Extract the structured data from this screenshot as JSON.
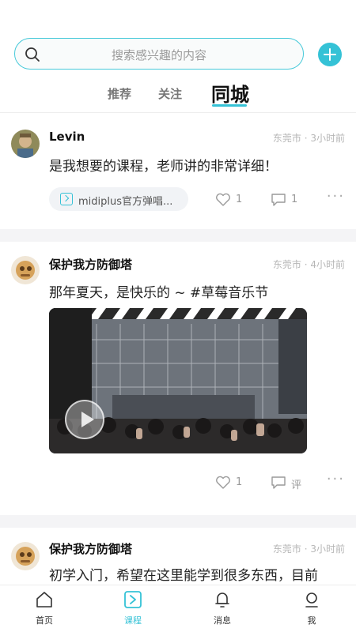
{
  "search": {
    "placeholder": "搜索感兴趣的内容"
  },
  "tabs": [
    {
      "label": "推荐"
    },
    {
      "label": "关注"
    },
    {
      "label": "同城",
      "active": true
    }
  ],
  "posts": [
    {
      "username": "Levin",
      "location": "东莞市",
      "time": "3小时前",
      "meta": "东莞市 · 3小时前",
      "content": "是我想要的课程，老师讲的非常详细！",
      "course": "midiplus官方弹唱...",
      "likes": "1",
      "comments": "1"
    },
    {
      "username": "保护我方防御塔",
      "location": "东莞市",
      "time": "4小时前",
      "meta": "东莞市 · 4小时前",
      "content": "那年夏天，是快乐的 ~ #草莓音乐节",
      "has_video": true,
      "likes": "1",
      "comments": "评"
    },
    {
      "username": "保护我方防御塔",
      "location": "东莞市",
      "time": "3小时前",
      "meta": "东莞市 · 3小时前",
      "content": "初学入门，希望在这里能学到很多东西，目前"
    }
  ],
  "bottom_nav": [
    {
      "label": "首页",
      "icon": "home-icon"
    },
    {
      "label": "课程",
      "icon": "course-icon",
      "active": true
    },
    {
      "label": "消息",
      "icon": "bell-icon"
    },
    {
      "label": "我",
      "icon": "profile-icon"
    }
  ],
  "colors": {
    "accent": "#35c2d6",
    "gap": "#f4f4f6",
    "meta": "#b6b6b6"
  }
}
